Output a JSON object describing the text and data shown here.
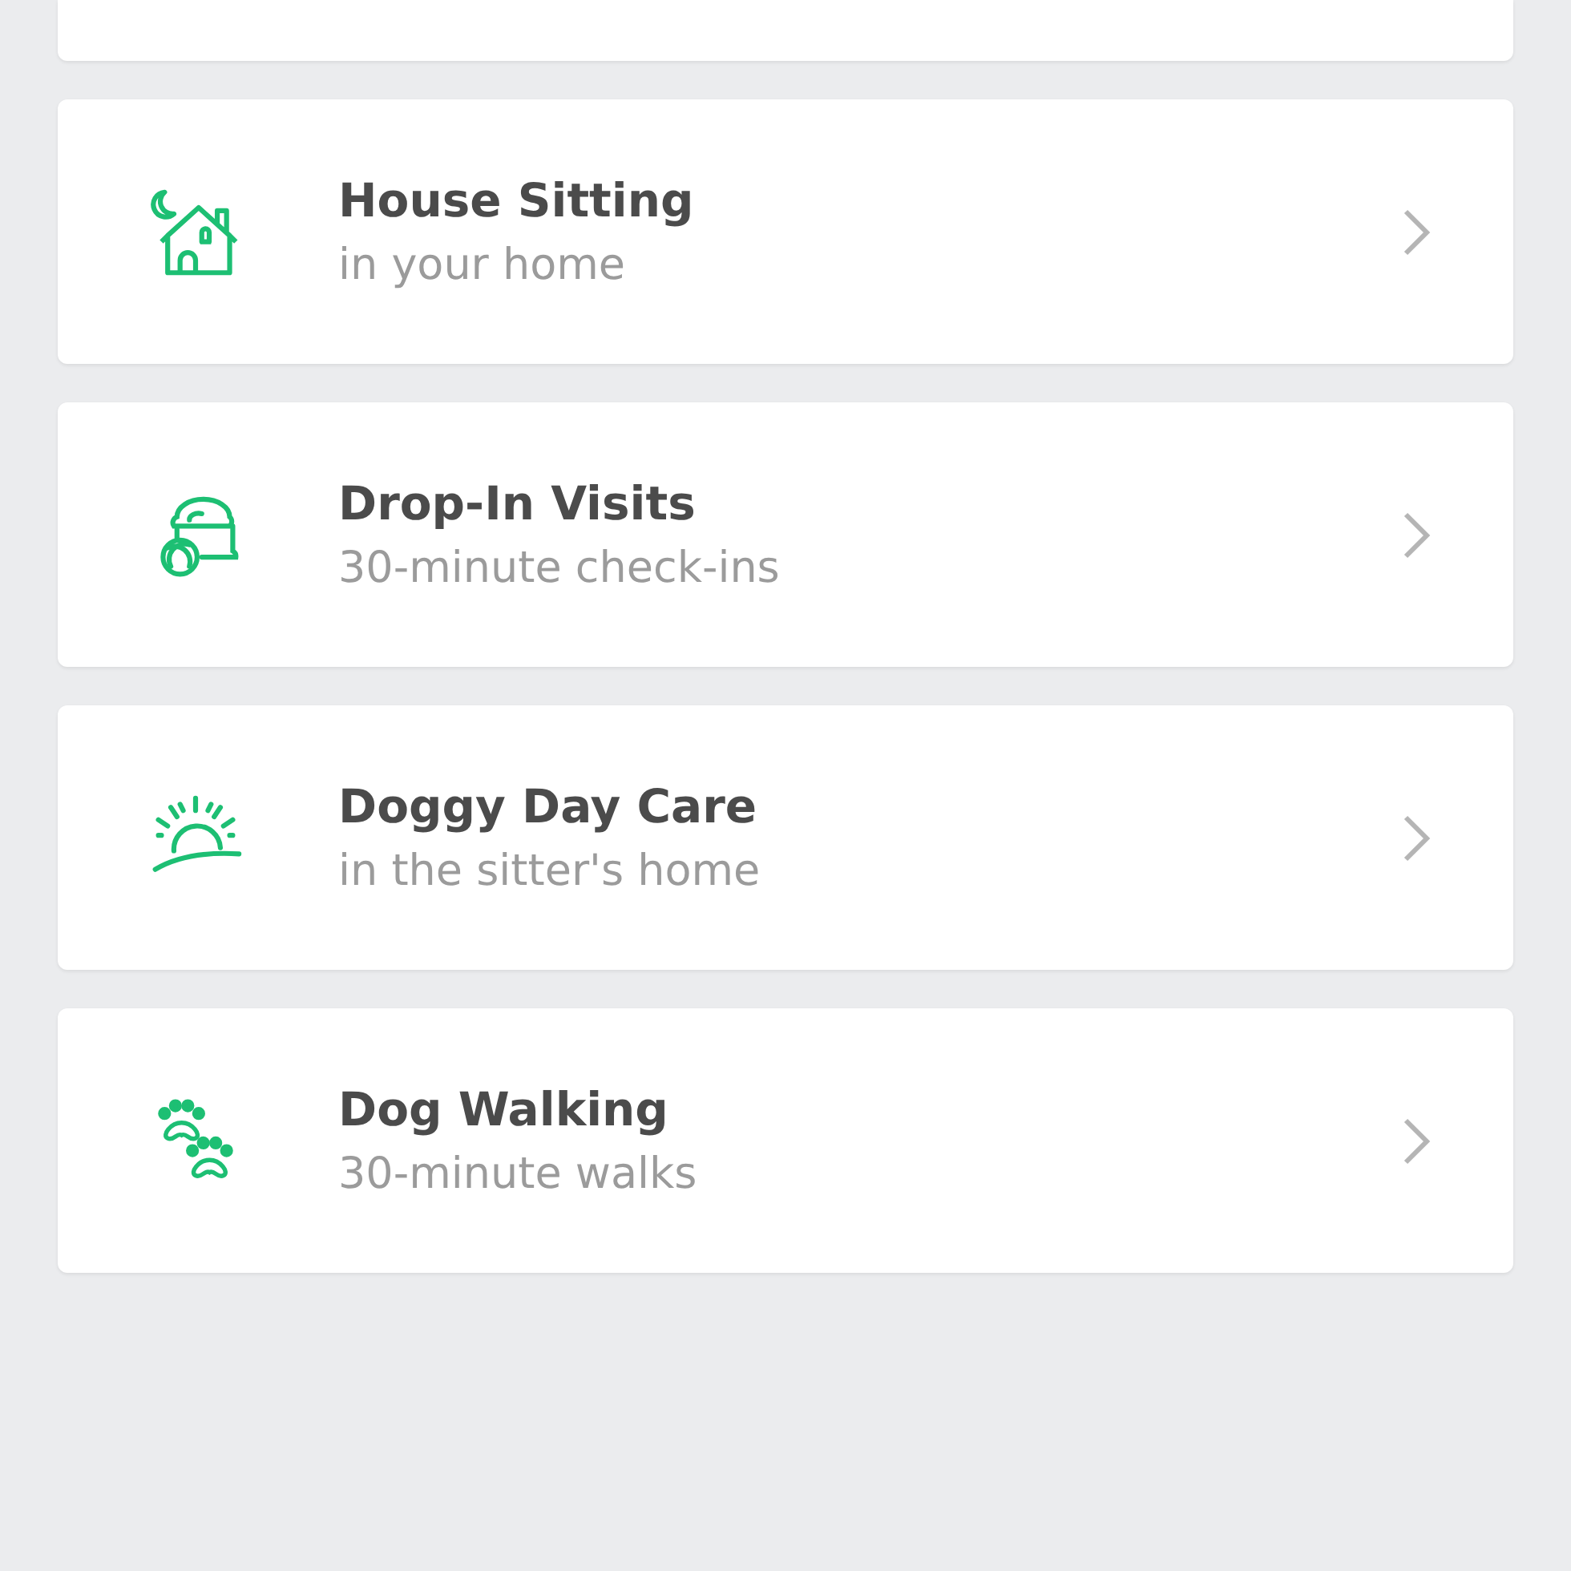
{
  "services": [
    {
      "kind": "house",
      "title": "House Sitting",
      "subtitle": "in your home"
    },
    {
      "kind": "bowl",
      "title": "Drop-In Visits",
      "subtitle": "30-minute check-ins"
    },
    {
      "kind": "sun",
      "title": "Doggy Day Care",
      "subtitle": "in the sitter's home"
    },
    {
      "kind": "paws",
      "title": "Dog Walking",
      "subtitle": "30-minute walks"
    }
  ]
}
